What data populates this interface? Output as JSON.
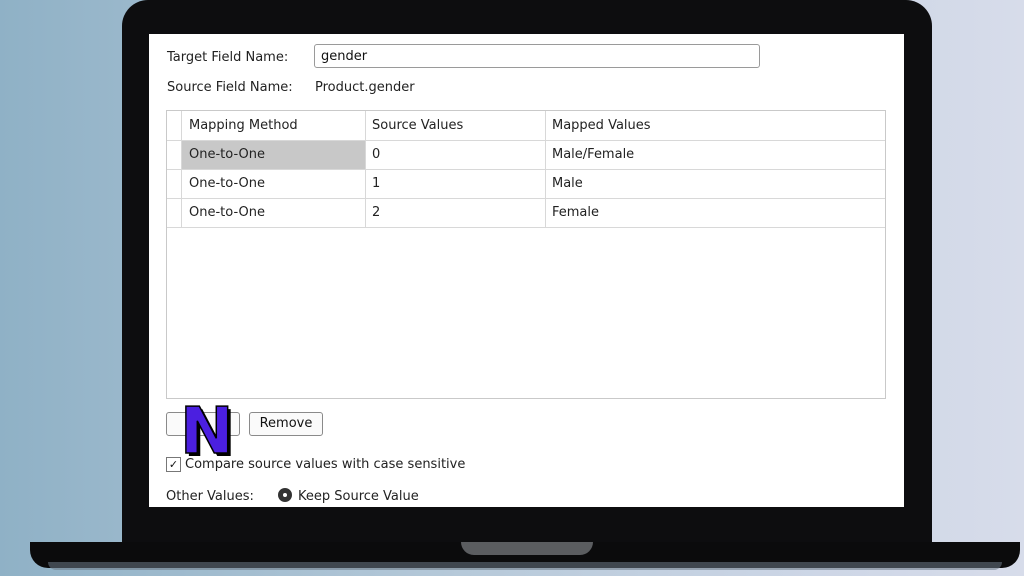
{
  "form": {
    "target_label": "Target Field Name:",
    "target_value": "gender",
    "source_label": "Source Field Name:",
    "source_value": "Product.gender"
  },
  "grid": {
    "headers": [
      "Mapping Method",
      "Source Values",
      "Mapped Values"
    ],
    "rows": [
      [
        "One-to-One",
        "0",
        "Male/Female"
      ],
      [
        "One-to-One",
        "1",
        "Male"
      ],
      [
        "One-to-One",
        "2",
        "Female"
      ]
    ]
  },
  "buttons": {
    "add_label": "",
    "remove_label": "Remove"
  },
  "options": {
    "case_sensitive_label": "Compare source values with case sensitive",
    "case_sensitive_checked": true,
    "checkmark": "✓",
    "other_values_label": "Other Values:",
    "keep_source_label": "Keep Source Value"
  },
  "overlay": {
    "logo_letter": "N",
    "logo_color": "#4b1fe0"
  }
}
